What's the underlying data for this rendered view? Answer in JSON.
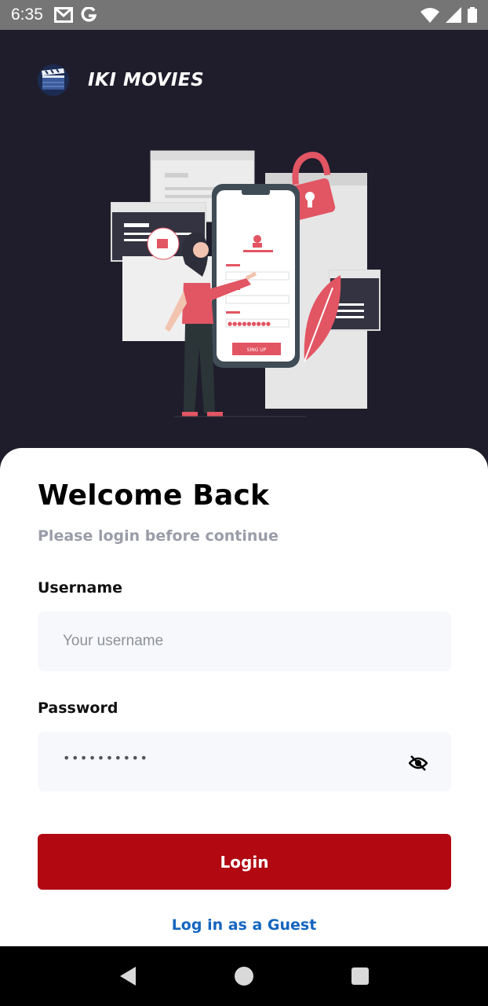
{
  "status_bar": {
    "time": "6:35",
    "icons_left": [
      "gmail-icon",
      "google-icon"
    ],
    "icons_right": [
      "wifi-icon",
      "cell-signal-icon",
      "battery-icon"
    ]
  },
  "brand": {
    "name": "IKI MOVIES",
    "logo_icon": "clapperboard-icon"
  },
  "illustration": {
    "button_text": "SING UP"
  },
  "login": {
    "title": "Welcome Back",
    "subtitle": "Please login before continue",
    "username_label": "Username",
    "username_placeholder": "Your username",
    "username_value": "",
    "password_label": "Password",
    "password_masked": "••••••••••",
    "password_toggle_icon": "eye-off-icon",
    "login_button": "Login",
    "guest_link": "Log in as a Guest"
  },
  "nav_bar": {
    "buttons": [
      "back-icon",
      "home-icon",
      "recents-icon"
    ]
  },
  "colors": {
    "background": "#1f1d2b",
    "primary": "#b10812",
    "link": "#1565c0",
    "input_bg": "#f6f8fc",
    "subtitle": "#9a9da8"
  }
}
